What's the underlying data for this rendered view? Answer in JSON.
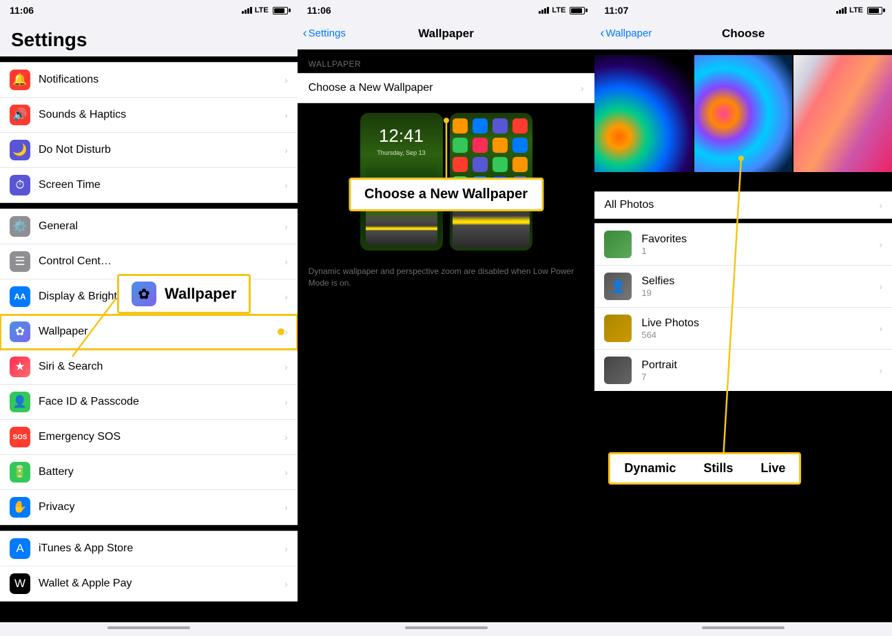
{
  "panel1": {
    "status": {
      "time": "11:06",
      "lte": "LTE"
    },
    "title": "Settings",
    "sections": [
      {
        "items": [
          {
            "id": "notifications",
            "label": "Notifications",
            "icon": "🔔",
            "color": "#ff3b30"
          },
          {
            "id": "sounds",
            "label": "Sounds & Haptics",
            "icon": "🔊",
            "color": "#ff3b30"
          },
          {
            "id": "donotdisturb",
            "label": "Do Not Disturb",
            "icon": "🌙",
            "color": "#5856d6"
          },
          {
            "id": "screentime",
            "label": "Screen Time",
            "icon": "⏱",
            "color": "#5856d6"
          }
        ]
      },
      {
        "items": [
          {
            "id": "general",
            "label": "General",
            "icon": "⚙️",
            "color": "#8e8e93"
          },
          {
            "id": "controlcenter",
            "label": "Control Cent…",
            "icon": "☰",
            "color": "#8e8e93"
          },
          {
            "id": "display",
            "label": "Display & Brightness",
            "icon": "AA",
            "color": "#007aff"
          },
          {
            "id": "wallpaper",
            "label": "Wallpaper",
            "icon": "✿",
            "color": "#007aff",
            "highlighted": true
          },
          {
            "id": "siri",
            "label": "Siri & Search",
            "icon": "★",
            "color": "#ff2d55"
          },
          {
            "id": "faceid",
            "label": "Face ID & Passcode",
            "icon": "👤",
            "color": "#34c759"
          },
          {
            "id": "emergencysos",
            "label": "Emergency SOS",
            "icon": "SOS",
            "color": "#ff3b30"
          },
          {
            "id": "battery",
            "label": "Battery",
            "icon": "⚡",
            "color": "#34c759"
          },
          {
            "id": "privacy",
            "label": "Privacy",
            "icon": "✋",
            "color": "#007aff"
          }
        ]
      },
      {
        "items": [
          {
            "id": "itunes",
            "label": "iTunes & App Store",
            "icon": "A",
            "color": "#007aff"
          },
          {
            "id": "wallet",
            "label": "Wallet & Apple Pay",
            "icon": "W",
            "color": "#000"
          }
        ]
      }
    ],
    "callout": {
      "label": "Wallpaper"
    }
  },
  "panel2": {
    "status": {
      "time": "11:06",
      "lte": "LTE"
    },
    "back_label": "Settings",
    "title": "Wallpaper",
    "section_header": "WALLPAPER",
    "choose_row": "Choose a New Wallpaper",
    "note": "Dynamic wallpaper and perspective zoom are disabled when Low Power Mode is on.",
    "callout": "Choose a New Wallpaper"
  },
  "panel3": {
    "status": {
      "time": "11:07",
      "lte": "LTE"
    },
    "back_label": "Wallpaper",
    "title": "Choose",
    "categories_top": [
      {
        "id": "dynamic",
        "label": "Dynamic"
      },
      {
        "id": "stills",
        "label": "Stills"
      },
      {
        "id": "live",
        "label": "Live"
      }
    ],
    "all_photos_label": "All Photos",
    "categories_list": [
      {
        "id": "favorites",
        "name": "Favorites",
        "count": "1"
      },
      {
        "id": "selfies",
        "name": "Selfies",
        "count": "19"
      },
      {
        "id": "live-photos",
        "name": "Live Photos",
        "count": "564"
      },
      {
        "id": "portrait",
        "name": "Portrait",
        "count": "7"
      }
    ],
    "callout": {
      "dynamic": "Dynamic",
      "stills": "Stills",
      "live": "Live"
    }
  }
}
